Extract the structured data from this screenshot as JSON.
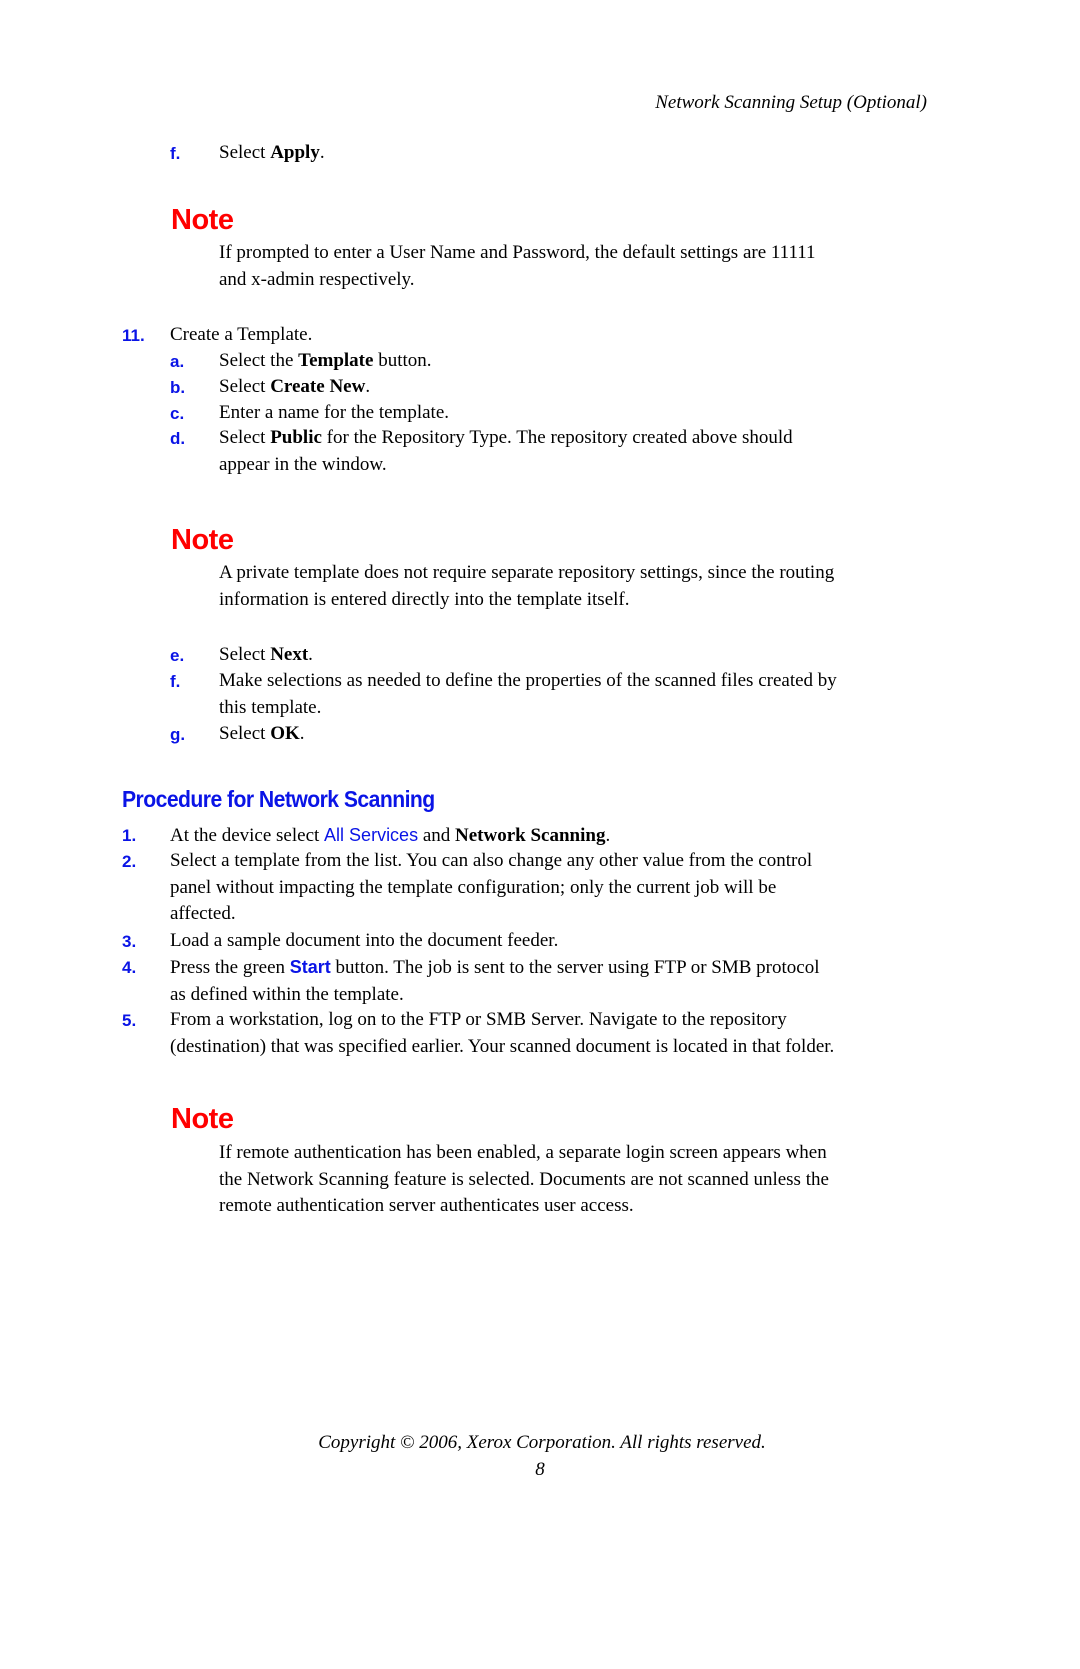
{
  "header": {
    "running_title": "Network Scanning Setup (Optional)"
  },
  "colors": {
    "marker_blue": "#0a14e6",
    "note_red": "#ff0000",
    "text": "#000000"
  },
  "step_f_top": {
    "marker": "f.",
    "pre": "Select ",
    "bold": "Apply",
    "post": "."
  },
  "note1": {
    "title": "Note",
    "lines": [
      "If prompted to enter a User Name and Password, the default settings are 11111",
      "and x-admin respectively."
    ]
  },
  "step11": {
    "marker": "11.",
    "text": "Create a Template.",
    "substeps": [
      {
        "marker": "a.",
        "pre": "Select the ",
        "bold": "Template",
        "post": " button."
      },
      {
        "marker": "b.",
        "pre": "Select ",
        "bold": "Create New",
        "post": "."
      },
      {
        "marker": "c.",
        "pre": "Enter a name for the template.",
        "bold": "",
        "post": ""
      },
      {
        "marker": "d.",
        "pre": "Select ",
        "bold": "Public",
        "post": " for the Repository Type. The repository created above should",
        "line2": "appear in the window."
      }
    ]
  },
  "note2": {
    "title": "Note",
    "lines": [
      "A private template does not require separate repository settings, since the routing",
      "information is entered directly into the template itself."
    ]
  },
  "step11_cont": [
    {
      "marker": "e.",
      "pre": "Select ",
      "bold": "Next",
      "post": "."
    },
    {
      "marker": "f.",
      "line1": "Make selections as needed to define the properties of the scanned files created by",
      "line2": "this template."
    },
    {
      "marker": "g.",
      "pre": "Select ",
      "bold": "OK",
      "post": "."
    }
  ],
  "procedure": {
    "heading": "Procedure for Network Scanning",
    "steps": [
      {
        "marker": "1.",
        "pre": "At the device select ",
        "blue": "All Services",
        "mid": " and ",
        "bold": "Network Scanning",
        "post": "."
      },
      {
        "marker": "2.",
        "lines": [
          "Select a template from the list. You can also change any other value from the control",
          "panel without impacting the template configuration; only the current job will be",
          "affected."
        ]
      },
      {
        "marker": "3.",
        "lines": [
          "Load a sample document into the document feeder."
        ]
      },
      {
        "marker": "4.",
        "pre": "Press the green ",
        "blue": "Start",
        "post": " button. The job is sent to the server using FTP or SMB protocol",
        "line2": "as defined within the template."
      },
      {
        "marker": "5.",
        "lines": [
          "From a workstation, log on to the FTP or SMB Server. Navigate to the repository",
          "(destination) that was specified earlier. Your scanned document is located in that folder."
        ]
      }
    ]
  },
  "note3": {
    "title": "Note",
    "lines": [
      "If remote authentication has been enabled, a separate login screen appears when",
      "the Network Scanning feature is selected. Documents are not scanned unless the",
      "remote authentication server authenticates user access."
    ]
  },
  "footer": {
    "copyright": "Copyright © 2006, Xerox Corporation. All rights reserved.",
    "page_number": "8"
  }
}
